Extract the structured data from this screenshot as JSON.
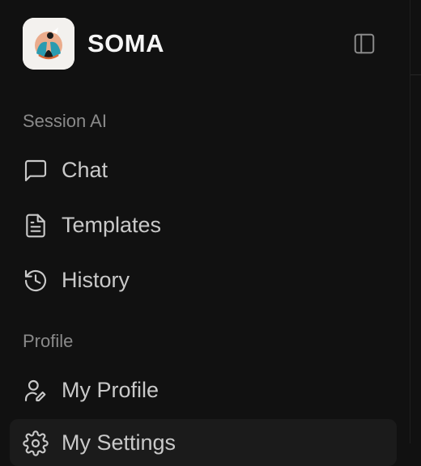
{
  "app": {
    "brand": "SOMA",
    "logo_icon": "soma-logo-icon",
    "collapse_icon": "sidebar-toggle-icon"
  },
  "sections": [
    {
      "label": "Session AI",
      "items": [
        {
          "label": "Chat",
          "icon": "chat-bubble-icon"
        },
        {
          "label": "Templates",
          "icon": "document-icon"
        },
        {
          "label": "History",
          "icon": "history-icon"
        }
      ]
    },
    {
      "label": "Profile",
      "items": [
        {
          "label": "My Profile",
          "icon": "user-edit-icon"
        },
        {
          "label": "My Settings",
          "icon": "gear-icon",
          "active": true
        }
      ]
    }
  ],
  "colors": {
    "background": "#111111",
    "active_item": "#1b1b1b",
    "section_text": "#8a8a8a",
    "item_text": "#c9c9c9",
    "brand_text": "#f5f5f5"
  }
}
